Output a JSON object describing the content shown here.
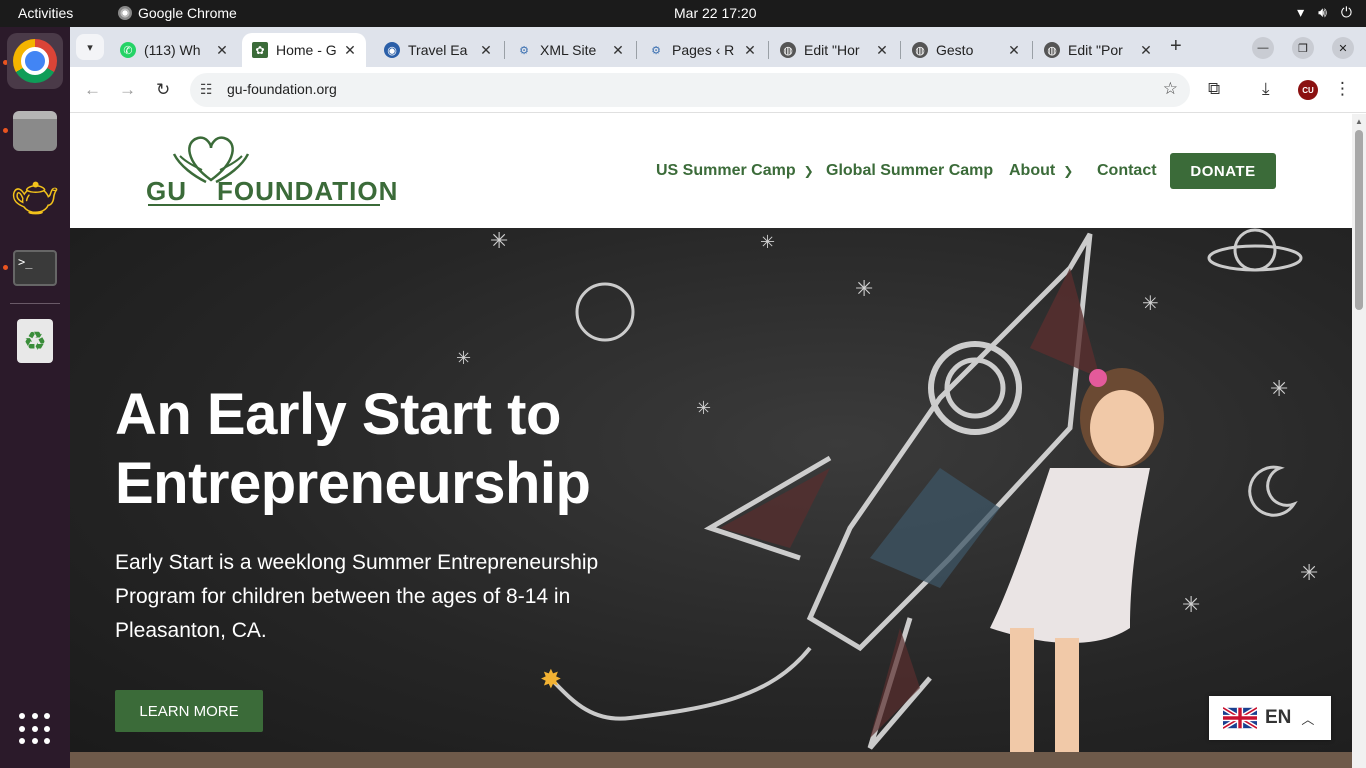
{
  "topbar": {
    "activities": "Activities",
    "app_name": "Google Chrome",
    "clock": "Mar 22  17:20"
  },
  "tabs": [
    {
      "title": "(113) Wh",
      "favicon": "whatsapp-icon"
    },
    {
      "title": "Home - G",
      "favicon": "gu-foundation-icon"
    },
    {
      "title": "Travel Ea",
      "favicon": "travel-icon"
    },
    {
      "title": "XML Site",
      "favicon": "sitemap-icon"
    },
    {
      "title": "Pages ‹ R",
      "favicon": "wordpress-icon"
    },
    {
      "title": "Edit \"Hor",
      "favicon": "globe-icon"
    },
    {
      "title": "Gesto",
      "favicon": "globe-icon"
    },
    {
      "title": "Edit \"Por",
      "favicon": "globe-icon"
    }
  ],
  "browser": {
    "url": "gu-foundation.org",
    "profile_initials": "CU"
  },
  "site": {
    "logo_left": "GU",
    "logo_right": "FOUNDATION",
    "nav": {
      "us_camp": "US Summer Camp",
      "global_camp": "Global Summer Camp",
      "about": "About",
      "contact": "Contact",
      "donate": "DONATE"
    },
    "hero": {
      "title": "An Early Start to Entrepreneurship",
      "text": "Early Start is a weeklong Summer Entrepreneurship Program for children between the ages of 8-14 in Pleasanton, CA.",
      "button": "LEARN MORE"
    },
    "language": "EN"
  },
  "colors": {
    "brand_green": "#3b6b39",
    "hero_bg": "#262626"
  }
}
